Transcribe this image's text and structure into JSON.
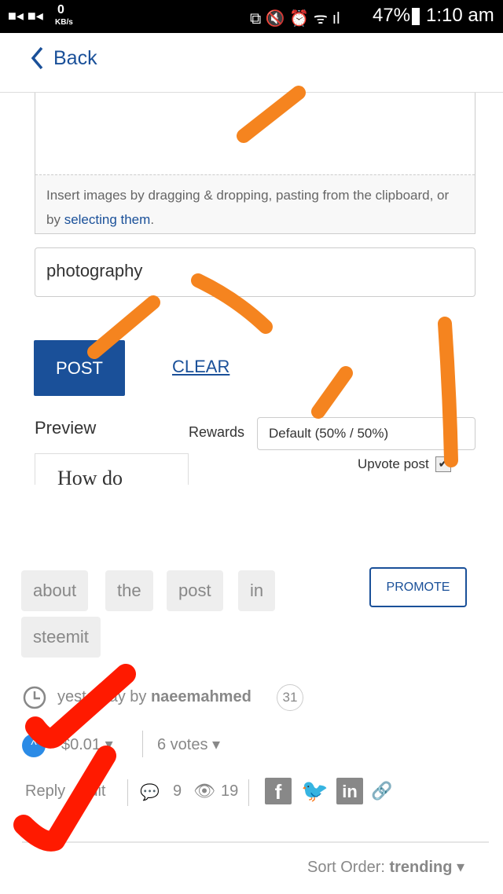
{
  "status_bar": {
    "kbs": "0",
    "kbs_unit": "KB/s",
    "battery": "47%",
    "time": "1:10 am"
  },
  "nav": {
    "back_label": "Back"
  },
  "editor": {
    "hint_prefix": "Insert images by dragging & dropping, pasting from the clipboard, or by ",
    "hint_link": "selecting them",
    "hint_suffix": "."
  },
  "tags_input": {
    "value": "photography"
  },
  "buttons": {
    "post": "POST",
    "clear": "CLEAR",
    "promote": "PROMOTE"
  },
  "preview": {
    "label": "Preview",
    "snippet": "How do"
  },
  "rewards": {
    "label": "Rewards",
    "selected": "Default (50% / 50%)"
  },
  "upvote": {
    "label": "Upvote post",
    "checked": true
  },
  "post_tags": [
    "about",
    "the",
    "post",
    "in",
    "steemit"
  ],
  "meta": {
    "time": "yesterday",
    "by": "by",
    "author": "naeemahmed",
    "reputation": "31"
  },
  "payout": {
    "amount": "$0.01",
    "votes": "6 votes"
  },
  "actions": {
    "reply": "Reply",
    "edit": "Edit",
    "comments": "9",
    "views": "19"
  },
  "sort": {
    "label": "Sort Order:",
    "value": "trending"
  },
  "colors": {
    "accent": "#1a5099",
    "annotation_orange": "#f5841f",
    "annotation_red": "#ff1a00"
  }
}
